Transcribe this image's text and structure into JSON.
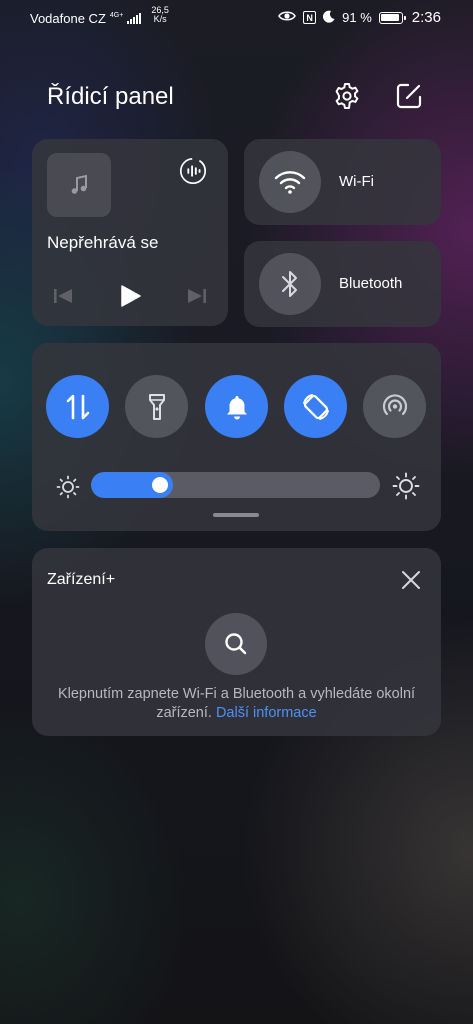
{
  "status_bar": {
    "carrier": "Vodafone CZ",
    "network_type": "4G+",
    "network_speed_value": "26,5",
    "network_speed_unit": "K/s",
    "nfc_label": "N",
    "battery_percent": "91 %",
    "battery_level": 0.91,
    "time": "2:36"
  },
  "header": {
    "title": "Řídicí panel"
  },
  "media": {
    "status": "Nepřehrává se"
  },
  "wifi": {
    "label": "Wi-Fi"
  },
  "bluetooth": {
    "label": "Bluetooth"
  },
  "toggles": [
    {
      "icon": "mobile-data-icon",
      "state": "on"
    },
    {
      "icon": "flashlight-icon",
      "state": "off"
    },
    {
      "icon": "bell-icon",
      "state": "on"
    },
    {
      "icon": "auto-rotate-icon",
      "state": "on"
    },
    {
      "icon": "hotspot-icon",
      "state": "off"
    }
  ],
  "brightness": {
    "level": 0.24
  },
  "device_plus": {
    "title": "Zařízení+",
    "description": "Klepnutím zapnete Wi-Fi a Bluetooth a vyhledáte okolní zařízení.",
    "link": "Další informace"
  },
  "colors": {
    "accent": "#3a7ff3",
    "link": "#4f8ff6",
    "card": "#34353c",
    "muted_text": "#b7b8be"
  }
}
